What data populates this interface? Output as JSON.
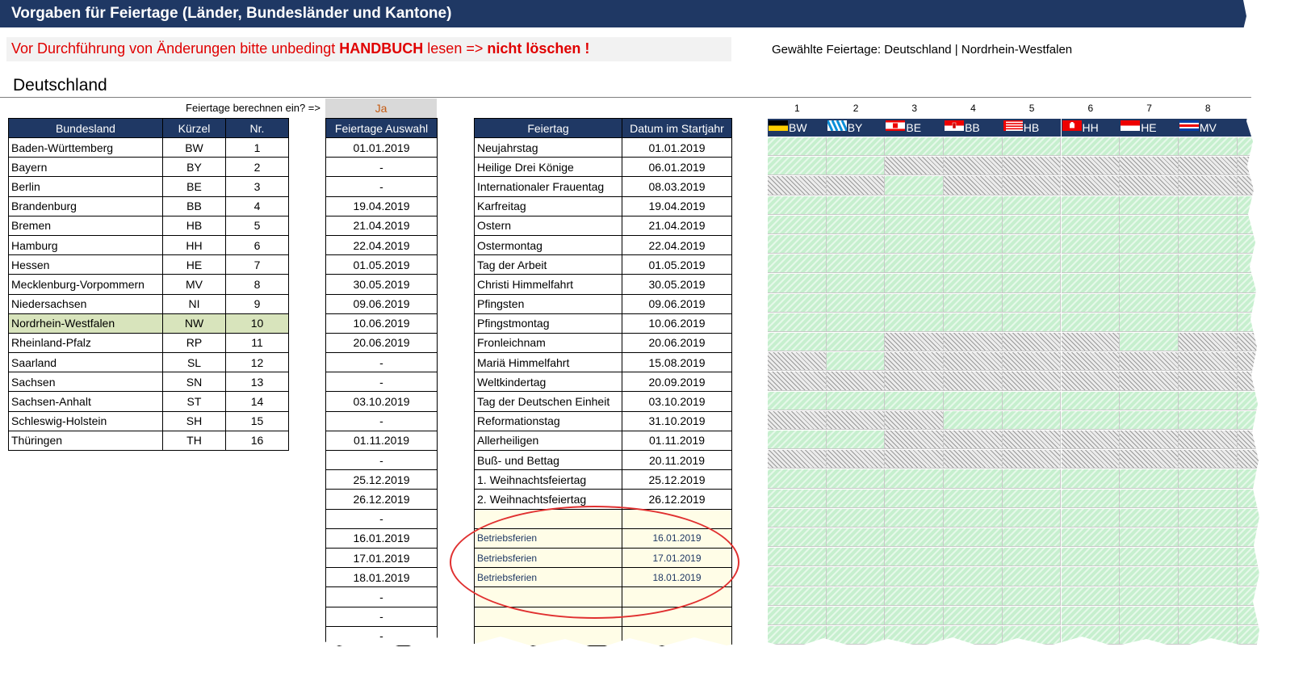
{
  "title": "Vorgaben für Feiertage  (Länder, Bundesländer und Kantone)",
  "warning": {
    "part1": "Vor Durchführung von Änderungen bitte unbedingt ",
    "handbuch": "HANDBUCH",
    "part2": " lesen => ",
    "part3": "nicht löschen !"
  },
  "selected_info": "Gewählte Feiertage: Deutschland | Nordrhein-Westfalen",
  "country": "Deutschland",
  "calc_label": "Feiertage berechnen ein? =>",
  "calc_value": "Ja",
  "bundeslaender": {
    "headers": [
      "Bundesland",
      "Kürzel",
      "Nr."
    ],
    "highlight_row": 9,
    "rows": [
      [
        "Baden-Württemberg",
        "BW",
        "1"
      ],
      [
        "Bayern",
        "BY",
        "2"
      ],
      [
        "Berlin",
        "BE",
        "3"
      ],
      [
        "Brandenburg",
        "BB",
        "4"
      ],
      [
        "Bremen",
        "HB",
        "5"
      ],
      [
        "Hamburg",
        "HH",
        "6"
      ],
      [
        "Hessen",
        "HE",
        "7"
      ],
      [
        "Mecklenburg-Vorpommern",
        "MV",
        "8"
      ],
      [
        "Niedersachsen",
        "NI",
        "9"
      ],
      [
        "Nordrhein-Westfalen",
        "NW",
        "10"
      ],
      [
        "Rheinland-Pfalz",
        "RP",
        "11"
      ],
      [
        "Saarland",
        "SL",
        "12"
      ],
      [
        "Sachsen",
        "SN",
        "13"
      ],
      [
        "Sachsen-Anhalt",
        "ST",
        "14"
      ],
      [
        "Schleswig-Holstein",
        "SH",
        "15"
      ],
      [
        "Thüringen",
        "TH",
        "16"
      ]
    ]
  },
  "auswahl": {
    "header": "Feiertage Auswahl",
    "values": [
      "01.01.2019",
      "-",
      "-",
      "19.04.2019",
      "21.04.2019",
      "22.04.2019",
      "01.05.2019",
      "30.05.2019",
      "09.06.2019",
      "10.06.2019",
      "20.06.2019",
      "-",
      "-",
      "03.10.2019",
      "-",
      "01.11.2019",
      "-",
      "25.12.2019",
      "26.12.2019",
      "-",
      "16.01.2019",
      "17.01.2019",
      "18.01.2019",
      "-",
      "-",
      "-"
    ]
  },
  "feiertage": {
    "headers": [
      "Feiertag",
      "Datum im Startjahr"
    ],
    "rows": [
      [
        "Neujahrstag",
        "01.01.2019"
      ],
      [
        "Heilige Drei Könige",
        "06.01.2019"
      ],
      [
        "Internationaler Frauentag",
        "08.03.2019"
      ],
      [
        "Karfreitag",
        "19.04.2019"
      ],
      [
        "Ostern",
        "21.04.2019"
      ],
      [
        "Ostermontag",
        "22.04.2019"
      ],
      [
        "Tag der Arbeit",
        "01.05.2019"
      ],
      [
        "Christi Himmelfahrt",
        "30.05.2019"
      ],
      [
        "Pfingsten",
        "09.06.2019"
      ],
      [
        "Pfingstmontag",
        "10.06.2019"
      ],
      [
        "Fronleichnam",
        "20.06.2019"
      ],
      [
        "Mariä Himmelfahrt",
        "15.08.2019"
      ],
      [
        "Weltkindertag",
        "20.09.2019"
      ],
      [
        "Tag der Deutschen Einheit",
        "03.10.2019"
      ],
      [
        "Reformationstag",
        "31.10.2019"
      ],
      [
        "Allerheiligen",
        "01.11.2019"
      ],
      [
        "Buß- und Bettag",
        "20.11.2019"
      ],
      [
        "1. Weihnachtsfeiertag",
        "25.12.2019"
      ],
      [
        "2. Weihnachtsfeiertag",
        "26.12.2019"
      ],
      [
        "",
        ""
      ],
      [
        "Betriebsferien",
        "16.01.2019"
      ],
      [
        "Betriebsferien",
        "17.01.2019"
      ],
      [
        "Betriebsferien",
        "18.01.2019"
      ],
      [
        "",
        ""
      ],
      [
        "",
        ""
      ],
      [
        "",
        ""
      ]
    ]
  },
  "state_matrix": {
    "columns": [
      {
        "nr": "1",
        "code": "BW",
        "flag": "bw"
      },
      {
        "nr": "2",
        "code": "BY",
        "flag": "by"
      },
      {
        "nr": "3",
        "code": "BE",
        "flag": "be"
      },
      {
        "nr": "4",
        "code": "BB",
        "flag": "bb"
      },
      {
        "nr": "5",
        "code": "HB",
        "flag": "hb"
      },
      {
        "nr": "6",
        "code": "HH",
        "flag": "hh"
      },
      {
        "nr": "7",
        "code": "HE",
        "flag": "he"
      },
      {
        "nr": "8",
        "code": "MV",
        "flag": "mv"
      }
    ],
    "legend": {
      "g": "holiday-applies",
      "x": "holiday-not-applicable"
    },
    "rows": [
      "gggggggg",
      "ggxxxxxx",
      "xxgxxxxx",
      "gggggggg",
      "gggggggg",
      "gggggggg",
      "gggggggg",
      "gggggggg",
      "gggggggg",
      "gggggggg",
      "ggxxxxgx",
      "xgxxxxxx",
      "xxxxxxxx",
      "gggggggg",
      "xxxggggg",
      "ggxxxxxx",
      "xxxxxxxx",
      "gggggggg",
      "gggggggg",
      "gggggggg",
      "gggggggg",
      "gggggggg",
      "gggggggg",
      "gggggggg",
      "gggggggg",
      "gggggggg"
    ]
  },
  "colors": {
    "header_bg": "#1f3864",
    "warning": "#e00000",
    "highlight_row": "#d8e4bc",
    "green_cell": "#c6efce",
    "annotation_oval": "#e03030"
  }
}
